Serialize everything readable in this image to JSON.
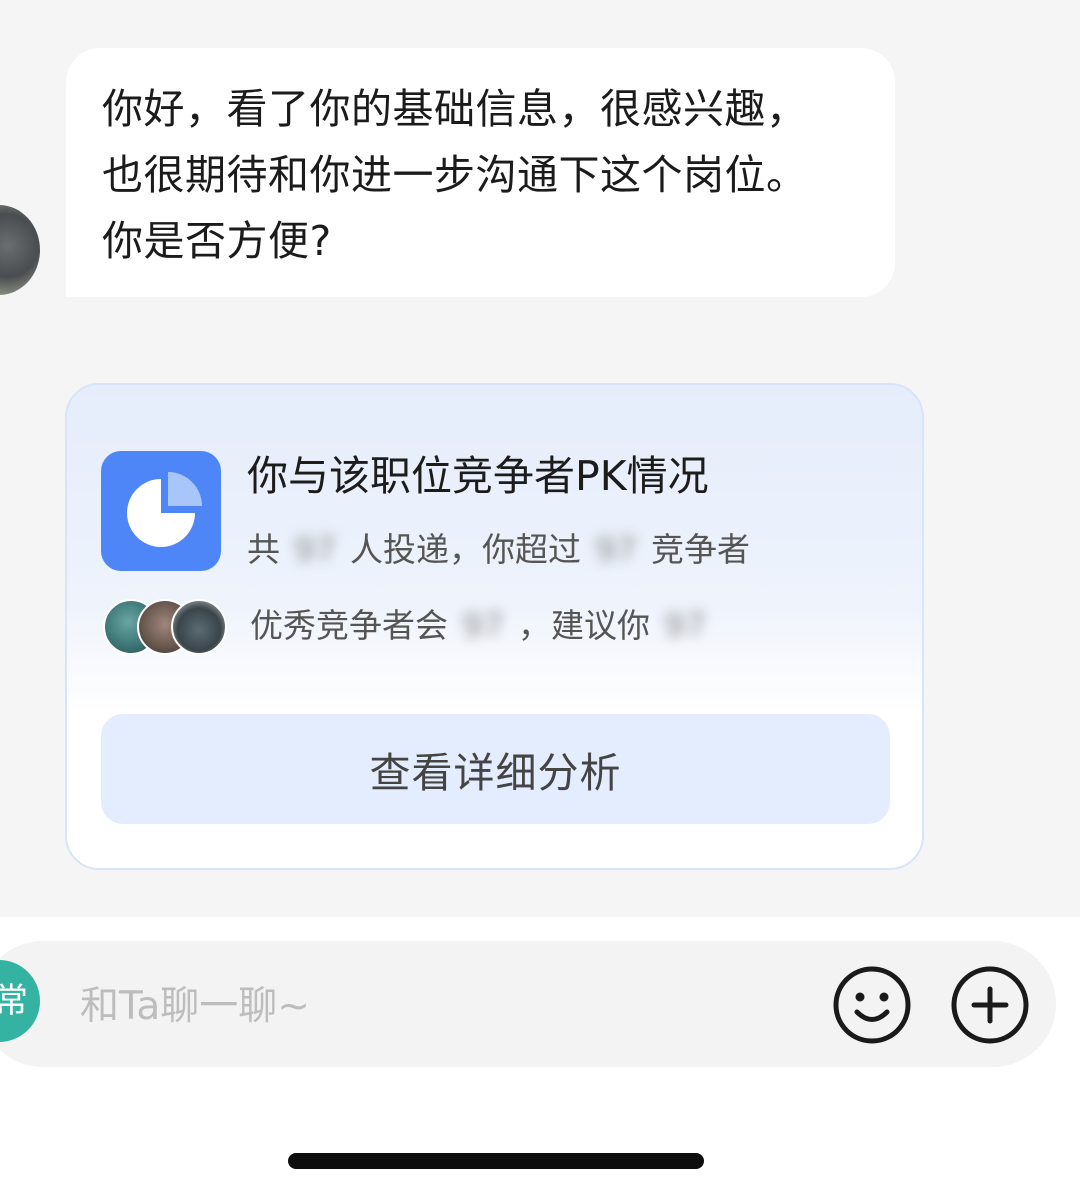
{
  "message": {
    "text": "你好，看了你的基础信息，很感兴趣，\n也很期待和你进一步沟通下这个岗位。\n你是否方便?"
  },
  "pk_card": {
    "icon": "pie-chart-icon",
    "title": "你与该职位竞争者PK情况",
    "line1": {
      "prefix": "共",
      "applicants_blurred": "97",
      "middle": "人投递，你超过",
      "exceeded_blurred": "97",
      "suffix": "竞争者"
    },
    "line2": {
      "prefix": "优秀竞争者会",
      "trait_blurred": "97",
      "middle": "，建议你",
      "advice_blurred": "97"
    },
    "button_label": "查看详细分析"
  },
  "input_bar": {
    "quick_reply_label": "常",
    "placeholder": "和Ta聊一聊~",
    "emoji_icon": "smiley-icon",
    "plus_icon": "plus-circle-icon"
  },
  "colors": {
    "background": "#f5f5f5",
    "card_accent": "#4f86f7",
    "button_bg": "#e4edfd",
    "quick_reply": "#34b3a3"
  }
}
